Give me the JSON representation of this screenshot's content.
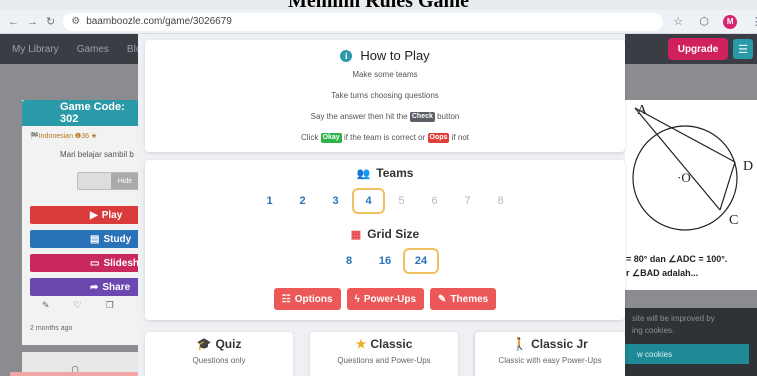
{
  "overlay": {
    "title": "Memilih Rules Game"
  },
  "browser": {
    "url": "baamboozle.com/game/3026679",
    "avatar_letter": "M"
  },
  "appbar": {
    "nav": [
      "My Library",
      "Games",
      "Blo"
    ],
    "upgrade": "Upgrade"
  },
  "left_panel": {
    "game_code": "Game Code: 302",
    "meta": "🏁Indonesian ❶36 ★",
    "subtitle": "Mari belajar sambil b",
    "hide_label": "Hide",
    "buttons": {
      "play": "Play",
      "study": "Study",
      "slideshow": "Slidesho",
      "share": "Share"
    },
    "time_ago": "2 months ago"
  },
  "right_panel": {
    "label_a": "A",
    "label_d": "D",
    "label_c": "C",
    "label_o": "·O",
    "line1": "= 80° dan ∠ADC = 100°.",
    "line2": "r ∠BAD adalah...",
    "cookie_text_1": "site will be improved by",
    "cookie_text_2": "ing cookies.",
    "cookie_btn": "w cookies"
  },
  "how_to_play": {
    "title": "How to Play",
    "line1": "Make some teams",
    "line2": "Take turns choosing questions",
    "line3_pre": "Say the answer then hit the",
    "check": "Check",
    "line3_post": "button",
    "line4_pre": "Click",
    "okay": "Okay",
    "line4_mid": "if the team is correct or",
    "oops": "Oops",
    "line4_post": "if not"
  },
  "teams": {
    "title": "Teams",
    "options": [
      {
        "label": "1",
        "state": "active"
      },
      {
        "label": "2",
        "state": "active"
      },
      {
        "label": "3",
        "state": "active"
      },
      {
        "label": "4",
        "state": "selected"
      },
      {
        "label": "5",
        "state": "dim"
      },
      {
        "label": "6",
        "state": "dim"
      },
      {
        "label": "7",
        "state": "dim"
      },
      {
        "label": "8",
        "state": "dim"
      }
    ]
  },
  "grid_size": {
    "title": "Grid Size",
    "options": [
      {
        "label": "8",
        "state": "active"
      },
      {
        "label": "16",
        "state": "active"
      },
      {
        "label": "24",
        "state": "selected"
      }
    ]
  },
  "actions": {
    "options": "Options",
    "powerups": "Power-Ups",
    "themes": "Themes"
  },
  "modes": {
    "quiz": {
      "title": "Quiz",
      "desc": "Questions only"
    },
    "classic": {
      "title": "Classic",
      "desc": "Questions and Power-Ups"
    },
    "classic_jr": {
      "title": "Classic Jr",
      "desc": "Classic with easy Power-Ups"
    }
  },
  "colors": {
    "teal": "#2a9aa8",
    "accent_red": "#ec5757",
    "selected_border": "#f0c060",
    "option_blue": "#2a72b8"
  }
}
